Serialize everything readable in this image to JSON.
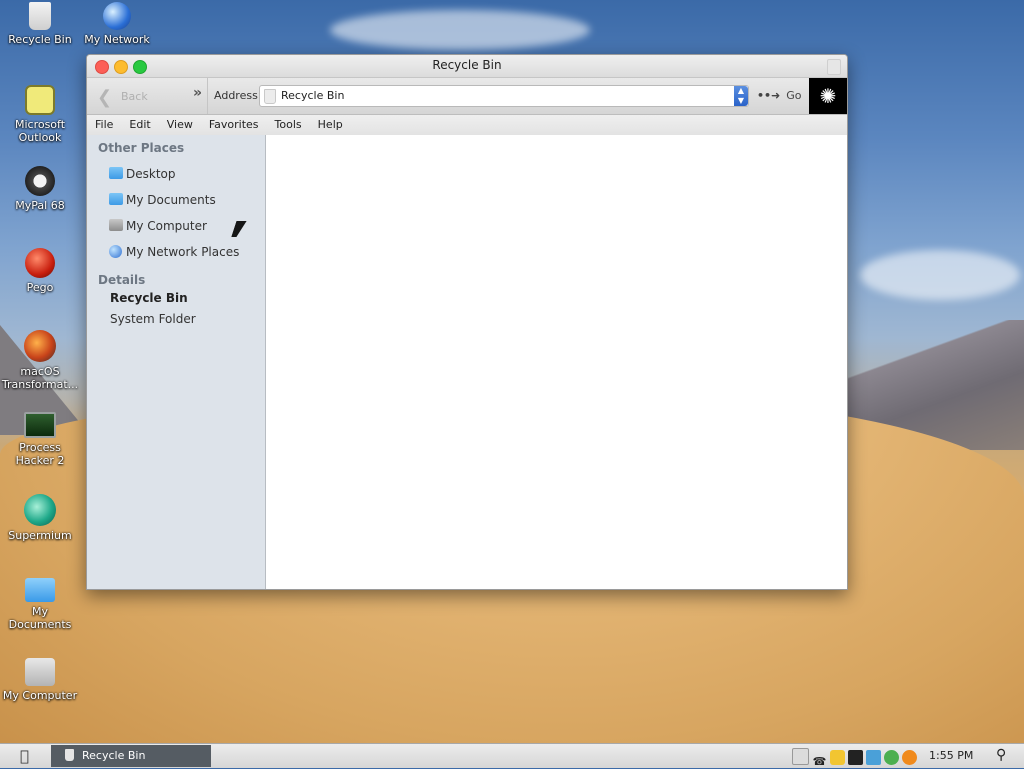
{
  "desktop": {
    "icons": [
      {
        "label": "Recycle Bin"
      },
      {
        "label": "My Network"
      },
      {
        "label": "Microsoft Outlook"
      },
      {
        "label": "MyPal 68"
      },
      {
        "label": "Pego"
      },
      {
        "label": "macOS Transformat..."
      },
      {
        "label": "Process Hacker 2"
      },
      {
        "label": "Supermium"
      },
      {
        "label": "My Documents"
      },
      {
        "label": "My Computer"
      }
    ]
  },
  "window": {
    "title": "Recycle Bin",
    "toolbar": {
      "back_label": "Back",
      "address_label": "Address",
      "address_value": "Recycle Bin",
      "go_label": "Go"
    },
    "menu": [
      "File",
      "Edit",
      "View",
      "Favorites",
      "Tools",
      "Help"
    ],
    "sidebar": {
      "other_places_title": "Other Places",
      "places": [
        {
          "label": "Desktop",
          "icon": "folder-icon"
        },
        {
          "label": "My Documents",
          "icon": "folder-icon"
        },
        {
          "label": "My Computer",
          "icon": "computer-icon"
        },
        {
          "label": "My Network Places",
          "icon": "globe-icon"
        }
      ],
      "details_title": "Details",
      "details_name": "Recycle Bin",
      "details_type": "System Folder"
    }
  },
  "taskbar": {
    "task_label": "Recycle Bin",
    "clock": "1:55 PM"
  },
  "colors": {
    "sidebar_bg": "#dde3ea",
    "task_button_bg": "#555c63",
    "close_light": "#fc5f57",
    "minimize_light": "#fdbc2e",
    "zoom_light": "#28c940"
  }
}
